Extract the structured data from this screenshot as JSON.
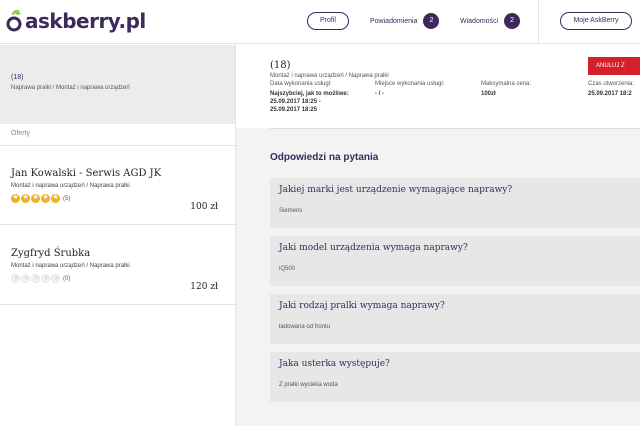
{
  "header": {
    "logo_text": "askberry.pl",
    "profil_label": "Profil",
    "powiadomienia_label": "Powiadomienia",
    "powiadomienia_count": "2",
    "wiadomosci_label": "Wiadomości",
    "wiadomosci_count": "2",
    "moje_label": "Moje AskBerry"
  },
  "left": {
    "count": "(18)",
    "breadcrumb": "Naprawa pralki / Montaż i naprawa urządzeń",
    "offers_label": "Oferty",
    "offers": [
      {
        "name": "Jan Kowalski - Serwis AGD JK",
        "category": "Montaż i naprawa urządzeń / Naprawa pralki",
        "rating": 5,
        "rating_count": "(5)",
        "price": "100 zł"
      },
      {
        "name": "Zygfryd Śrubka",
        "category": "Montaż i naprawa urządzeń / Naprawa pralki",
        "rating": 0,
        "rating_count": "(0)",
        "price": "120 zł"
      }
    ]
  },
  "order": {
    "count": "(18)",
    "breadcrumb": "Montaż i naprawa urządzeń / Naprawa pralki",
    "date_label": "Data wykonania usługi:",
    "date_value_line1": "Najszybciej, jak to możliwe:",
    "date_value_line2": "25.09.2017 18:25 -",
    "date_value_line3": "25.09.2017 18:25",
    "place_label": "Miejsce wykonania usługi:",
    "place_value": "- / -",
    "max_price_label": "Maksymalna cena:",
    "max_price_value": "100zł",
    "created_label": "Czas utworzenia:",
    "created_value": "25.09.2017 18:2",
    "cancel_label": "ANULUJ Z"
  },
  "answers": {
    "title": "Odpowiedzi na pytania",
    "items": [
      {
        "question": "Jakiej marki jest urządzenie wymagające naprawy?",
        "answer": "Siemens"
      },
      {
        "question": "Jaki model urządzenia wymaga naprawy?",
        "answer": "iQ500"
      },
      {
        "question": "Jaki rodzaj pralki wymaga naprawy?",
        "answer": "ładowana od frontu"
      },
      {
        "question": "Jaka usterka występuje?",
        "answer": "Z pralki wycieka woda"
      }
    ]
  },
  "colors": {
    "brand": "#3b2a5c",
    "accent_green": "#8dc63f",
    "star": "#f2b01e",
    "danger": "#d4202a"
  }
}
